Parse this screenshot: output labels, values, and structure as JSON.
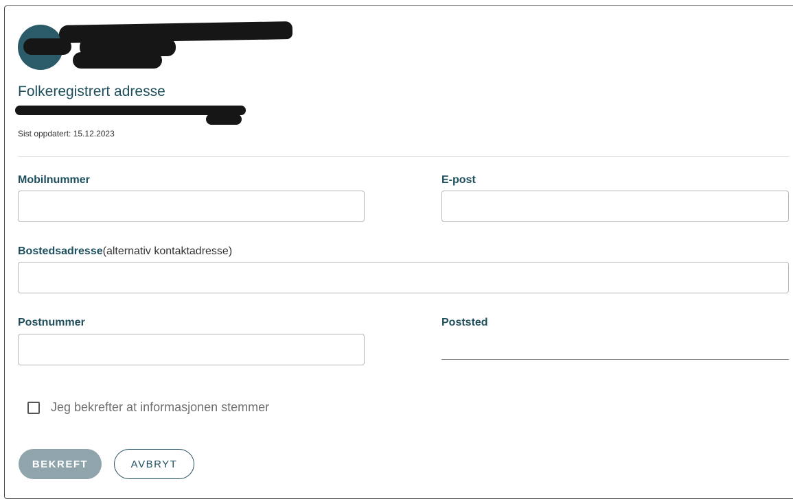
{
  "profile": {
    "address_heading": "Folkeregistrert adresse",
    "last_updated": "Sist oppdatert: 15.12.2023"
  },
  "form": {
    "mobile": {
      "label": "Mobilnummer",
      "value": ""
    },
    "email": {
      "label": "E-post",
      "value": ""
    },
    "residence": {
      "label": "Bostedsadresse",
      "hint": "(alternativ kontaktadresse)",
      "value": ""
    },
    "postal_code": {
      "label": "Postnummer",
      "value": ""
    },
    "postal_place": {
      "label": "Poststed",
      "value": ""
    },
    "confirm_checkbox": {
      "label": "Jeg bekrefter at informasjonen stemmer",
      "checked": false
    }
  },
  "actions": {
    "confirm_label": "BEKREFT",
    "cancel_label": "AVBRYT"
  },
  "colors": {
    "accent": "#1f4f5d",
    "avatar": "#2b5a68",
    "disabled_button": "#8fa4ab"
  }
}
